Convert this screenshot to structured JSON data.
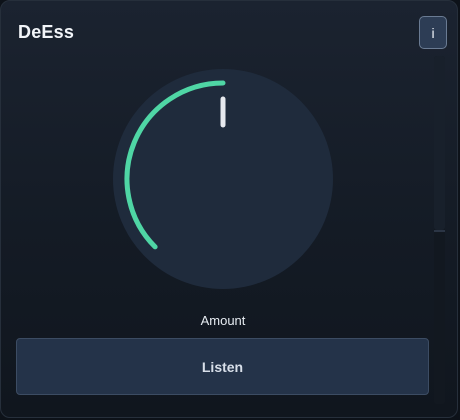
{
  "plugin": {
    "title": "DeEss",
    "info_label": "i"
  },
  "knob": {
    "label": "Amount",
    "value_fraction": 0.5,
    "accent_color": "#4fd6a5",
    "indicator_color": "#e6e9ee",
    "body_color": "#1f2b3c"
  },
  "listen": {
    "label": "Listen"
  }
}
